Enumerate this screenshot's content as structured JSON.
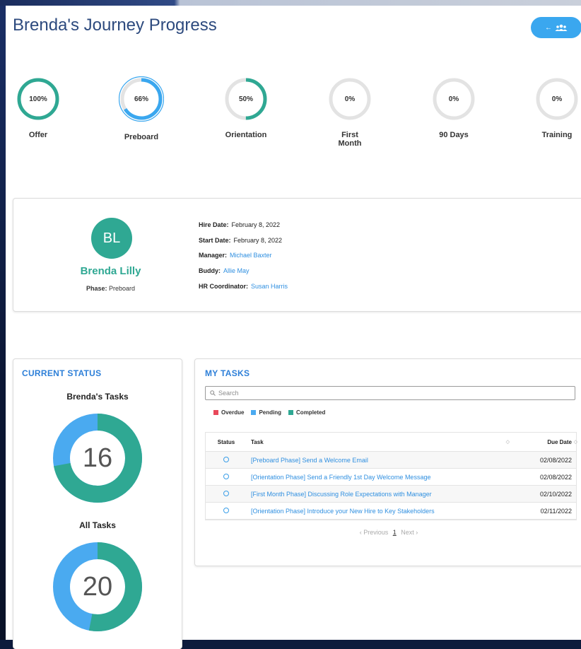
{
  "title": "Brenda's Journey Progress",
  "back_button": {
    "icon": "group-icon",
    "arrow": "←"
  },
  "phases": [
    {
      "label": "Offer",
      "percent_text": "100%",
      "progress": 1.0,
      "color": "#2fa893",
      "highlighted": false
    },
    {
      "label": "Preboard",
      "percent_text": "66%",
      "progress": 0.66,
      "color": "#3aa7ef",
      "highlighted": true
    },
    {
      "label": "Orientation",
      "percent_text": "50%",
      "progress": 0.5,
      "color": "#2fa893",
      "highlighted": false
    },
    {
      "label": "First Month",
      "percent_text": "0%",
      "progress": 0,
      "color": "#2fa893",
      "highlighted": false
    },
    {
      "label": "90 Days",
      "percent_text": "0%",
      "progress": 0,
      "color": "#2fa893",
      "highlighted": false
    },
    {
      "label": "Training",
      "percent_text": "0%",
      "progress": 0,
      "color": "#2fa893",
      "highlighted": false
    }
  ],
  "employee": {
    "initials": "BL",
    "name": "Brenda Lilly",
    "phase_label": "Phase:",
    "phase_value": "Preboard",
    "hire_date_label": "Hire Date:",
    "hire_date": "February 8, 2022",
    "start_date_label": "Start Date:",
    "start_date": "February 8, 2022",
    "manager_label": "Manager:",
    "manager": "Michael Baxter",
    "buddy_label": "Buddy:",
    "buddy": "Allie May",
    "hr_label": "HR Coordinator:",
    "hr": "Susan Harris"
  },
  "current_status": {
    "title": "CURRENT STATUS",
    "brenda_tasks_title": "Brenda's Tasks",
    "brenda_tasks_count": "16",
    "brenda_tasks_completed_fraction": 0.72,
    "all_tasks_title": "All Tasks",
    "all_tasks_count": "20",
    "all_tasks_completed_fraction": 0.53
  },
  "colors": {
    "completed": "#2fa893",
    "pending": "#4aaaf0",
    "overdue": "#e8485a"
  },
  "my_tasks": {
    "title": "MY TASKS",
    "search_placeholder": "Search",
    "legend": {
      "overdue": "Overdue",
      "pending": "Pending",
      "completed": "Completed"
    },
    "columns": {
      "status": "Status",
      "task": "Task",
      "due": "Due Date"
    },
    "rows": [
      {
        "task": "[Preboard Phase] Send a Welcome Email",
        "due": "02/08/2022"
      },
      {
        "task": "[Orientation Phase] Send a Friendly 1st Day Welcome Message",
        "due": "02/08/2022"
      },
      {
        "task": "[First Month Phase] Discussing Role Expectations with Manager",
        "due": "02/10/2022"
      },
      {
        "task": "[Orientation Phase] Introduce your New Hire to Key Stakeholders",
        "due": "02/11/2022"
      }
    ],
    "pager": {
      "previous": "‹ Previous",
      "page": "1",
      "next": "Next ›"
    }
  }
}
